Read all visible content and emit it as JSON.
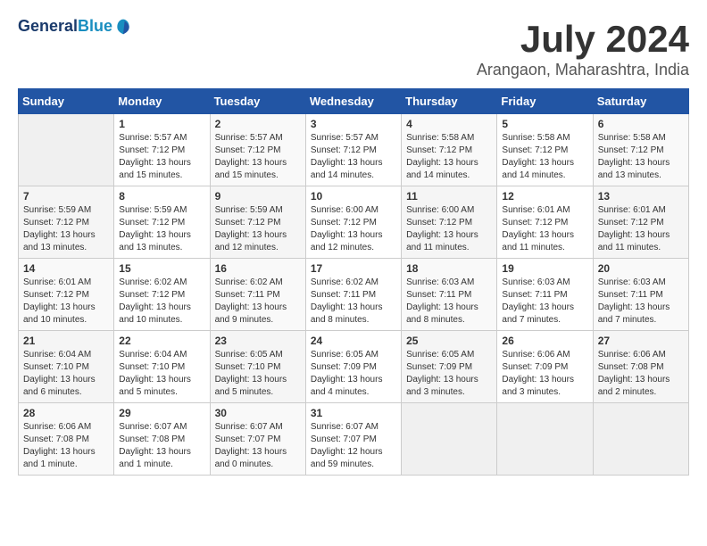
{
  "logo": {
    "line1": "General",
    "line2": "Blue"
  },
  "title": "July 2024",
  "location": "Arangaon, Maharashtra, India",
  "days_of_week": [
    "Sunday",
    "Monday",
    "Tuesday",
    "Wednesday",
    "Thursday",
    "Friday",
    "Saturday"
  ],
  "weeks": [
    [
      {
        "day": "",
        "sunrise": "",
        "sunset": "",
        "daylight": ""
      },
      {
        "day": "1",
        "sunrise": "Sunrise: 5:57 AM",
        "sunset": "Sunset: 7:12 PM",
        "daylight": "Daylight: 13 hours and 15 minutes."
      },
      {
        "day": "2",
        "sunrise": "Sunrise: 5:57 AM",
        "sunset": "Sunset: 7:12 PM",
        "daylight": "Daylight: 13 hours and 15 minutes."
      },
      {
        "day": "3",
        "sunrise": "Sunrise: 5:57 AM",
        "sunset": "Sunset: 7:12 PM",
        "daylight": "Daylight: 13 hours and 14 minutes."
      },
      {
        "day": "4",
        "sunrise": "Sunrise: 5:58 AM",
        "sunset": "Sunset: 7:12 PM",
        "daylight": "Daylight: 13 hours and 14 minutes."
      },
      {
        "day": "5",
        "sunrise": "Sunrise: 5:58 AM",
        "sunset": "Sunset: 7:12 PM",
        "daylight": "Daylight: 13 hours and 14 minutes."
      },
      {
        "day": "6",
        "sunrise": "Sunrise: 5:58 AM",
        "sunset": "Sunset: 7:12 PM",
        "daylight": "Daylight: 13 hours and 13 minutes."
      }
    ],
    [
      {
        "day": "7",
        "sunrise": "Sunrise: 5:59 AM",
        "sunset": "Sunset: 7:12 PM",
        "daylight": "Daylight: 13 hours and 13 minutes."
      },
      {
        "day": "8",
        "sunrise": "Sunrise: 5:59 AM",
        "sunset": "Sunset: 7:12 PM",
        "daylight": "Daylight: 13 hours and 13 minutes."
      },
      {
        "day": "9",
        "sunrise": "Sunrise: 5:59 AM",
        "sunset": "Sunset: 7:12 PM",
        "daylight": "Daylight: 13 hours and 12 minutes."
      },
      {
        "day": "10",
        "sunrise": "Sunrise: 6:00 AM",
        "sunset": "Sunset: 7:12 PM",
        "daylight": "Daylight: 13 hours and 12 minutes."
      },
      {
        "day": "11",
        "sunrise": "Sunrise: 6:00 AM",
        "sunset": "Sunset: 7:12 PM",
        "daylight": "Daylight: 13 hours and 11 minutes."
      },
      {
        "day": "12",
        "sunrise": "Sunrise: 6:01 AM",
        "sunset": "Sunset: 7:12 PM",
        "daylight": "Daylight: 13 hours and 11 minutes."
      },
      {
        "day": "13",
        "sunrise": "Sunrise: 6:01 AM",
        "sunset": "Sunset: 7:12 PM",
        "daylight": "Daylight: 13 hours and 11 minutes."
      }
    ],
    [
      {
        "day": "14",
        "sunrise": "Sunrise: 6:01 AM",
        "sunset": "Sunset: 7:12 PM",
        "daylight": "Daylight: 13 hours and 10 minutes."
      },
      {
        "day": "15",
        "sunrise": "Sunrise: 6:02 AM",
        "sunset": "Sunset: 7:12 PM",
        "daylight": "Daylight: 13 hours and 10 minutes."
      },
      {
        "day": "16",
        "sunrise": "Sunrise: 6:02 AM",
        "sunset": "Sunset: 7:11 PM",
        "daylight": "Daylight: 13 hours and 9 minutes."
      },
      {
        "day": "17",
        "sunrise": "Sunrise: 6:02 AM",
        "sunset": "Sunset: 7:11 PM",
        "daylight": "Daylight: 13 hours and 8 minutes."
      },
      {
        "day": "18",
        "sunrise": "Sunrise: 6:03 AM",
        "sunset": "Sunset: 7:11 PM",
        "daylight": "Daylight: 13 hours and 8 minutes."
      },
      {
        "day": "19",
        "sunrise": "Sunrise: 6:03 AM",
        "sunset": "Sunset: 7:11 PM",
        "daylight": "Daylight: 13 hours and 7 minutes."
      },
      {
        "day": "20",
        "sunrise": "Sunrise: 6:03 AM",
        "sunset": "Sunset: 7:11 PM",
        "daylight": "Daylight: 13 hours and 7 minutes."
      }
    ],
    [
      {
        "day": "21",
        "sunrise": "Sunrise: 6:04 AM",
        "sunset": "Sunset: 7:10 PM",
        "daylight": "Daylight: 13 hours and 6 minutes."
      },
      {
        "day": "22",
        "sunrise": "Sunrise: 6:04 AM",
        "sunset": "Sunset: 7:10 PM",
        "daylight": "Daylight: 13 hours and 5 minutes."
      },
      {
        "day": "23",
        "sunrise": "Sunrise: 6:05 AM",
        "sunset": "Sunset: 7:10 PM",
        "daylight": "Daylight: 13 hours and 5 minutes."
      },
      {
        "day": "24",
        "sunrise": "Sunrise: 6:05 AM",
        "sunset": "Sunset: 7:09 PM",
        "daylight": "Daylight: 13 hours and 4 minutes."
      },
      {
        "day": "25",
        "sunrise": "Sunrise: 6:05 AM",
        "sunset": "Sunset: 7:09 PM",
        "daylight": "Daylight: 13 hours and 3 minutes."
      },
      {
        "day": "26",
        "sunrise": "Sunrise: 6:06 AM",
        "sunset": "Sunset: 7:09 PM",
        "daylight": "Daylight: 13 hours and 3 minutes."
      },
      {
        "day": "27",
        "sunrise": "Sunrise: 6:06 AM",
        "sunset": "Sunset: 7:08 PM",
        "daylight": "Daylight: 13 hours and 2 minutes."
      }
    ],
    [
      {
        "day": "28",
        "sunrise": "Sunrise: 6:06 AM",
        "sunset": "Sunset: 7:08 PM",
        "daylight": "Daylight: 13 hours and 1 minute."
      },
      {
        "day": "29",
        "sunrise": "Sunrise: 6:07 AM",
        "sunset": "Sunset: 7:08 PM",
        "daylight": "Daylight: 13 hours and 1 minute."
      },
      {
        "day": "30",
        "sunrise": "Sunrise: 6:07 AM",
        "sunset": "Sunset: 7:07 PM",
        "daylight": "Daylight: 13 hours and 0 minutes."
      },
      {
        "day": "31",
        "sunrise": "Sunrise: 6:07 AM",
        "sunset": "Sunset: 7:07 PM",
        "daylight": "Daylight: 12 hours and 59 minutes."
      },
      {
        "day": "",
        "sunrise": "",
        "sunset": "",
        "daylight": ""
      },
      {
        "day": "",
        "sunrise": "",
        "sunset": "",
        "daylight": ""
      },
      {
        "day": "",
        "sunrise": "",
        "sunset": "",
        "daylight": ""
      }
    ]
  ]
}
